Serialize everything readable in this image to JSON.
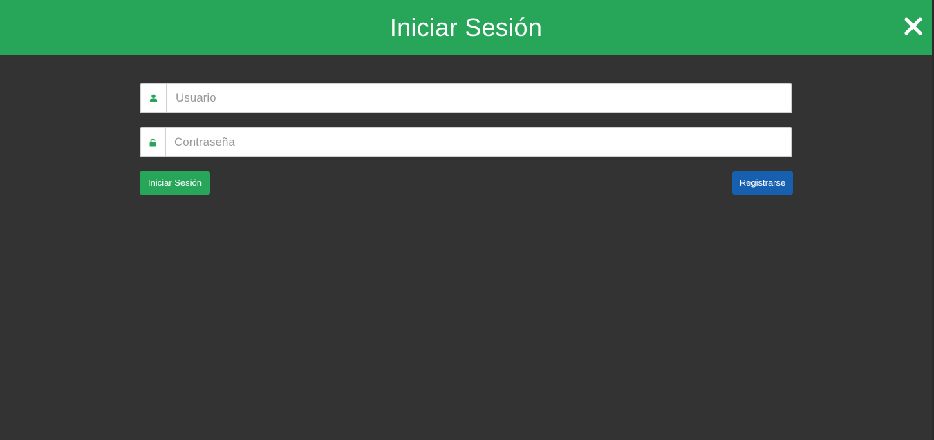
{
  "header": {
    "title": "Iniciar Sesión",
    "close_icon": "close-icon"
  },
  "form": {
    "username": {
      "placeholder": "Usuario",
      "value": "",
      "icon": "user-icon"
    },
    "password": {
      "placeholder": "Contraseña",
      "value": "",
      "icon": "unlock-icon"
    },
    "login_label": "Iniciar Sesión",
    "register_label": "Registrarse"
  },
  "colors": {
    "header_bg": "#27a65a",
    "body_bg": "#333333",
    "login_button": "#27a65a",
    "register_button": "#1760b0",
    "icon": "#27a65a"
  }
}
